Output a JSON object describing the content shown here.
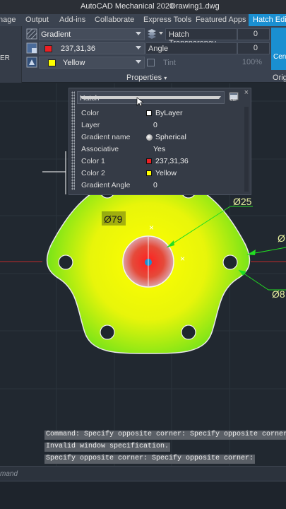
{
  "title_bar": {
    "app": "AutoCAD Mechanical 2020",
    "document": "Drawing1.dwg"
  },
  "ribbon_tabs": [
    "nage",
    "Output",
    "Add-ins",
    "Collaborate",
    "Express Tools",
    "Featured Apps",
    "Hatch Edito"
  ],
  "active_tab": "Hatch Edito",
  "ribbon": {
    "left_label": "ER",
    "hatch_type": "Gradient",
    "color1": "237,31,36",
    "color2": "Yellow",
    "hatch_transparency_label": "Hatch Transparency",
    "hatch_transparency_value": "0",
    "angle_label": "Angle",
    "angle_value": "0",
    "tint_label": "Tint",
    "tint_value": "100%",
    "panel_label": "Properties",
    "origin_label": "Origi",
    "center_button": "Cent"
  },
  "quick_properties": {
    "object_type": "Hatch",
    "rows": [
      {
        "key": "Color",
        "value": "ByLayer",
        "swatch": "#ffffff"
      },
      {
        "key": "Layer",
        "value": "0"
      },
      {
        "key": "Gradient name",
        "value": "Spherical",
        "swatch": "sphere"
      },
      {
        "key": "Associative",
        "value": "Yes"
      },
      {
        "key": "Color 1",
        "value": "237,31,36",
        "swatch": "#ed1f24"
      },
      {
        "key": "Color 2",
        "value": "Yellow",
        "swatch": "#ffff00"
      },
      {
        "key": "Gradient Angle",
        "value": "0"
      }
    ]
  },
  "dimensions": {
    "d79": "Ø79",
    "d25": "Ø25",
    "d_right_top": "Ø",
    "d_right_bottom": "Ø8"
  },
  "command_history": [
    "Command: Specify opposite corner: Specify opposite corner:",
    "Invalid window specification.",
    "Specify opposite corner: Specify opposite corner:"
  ],
  "command_prompt": "mand",
  "colors": {
    "accent": "#1a8fd1",
    "gradient_center": "#ed1f24",
    "gradient_edge": "#ffff00",
    "dimension": "#22dd22"
  }
}
